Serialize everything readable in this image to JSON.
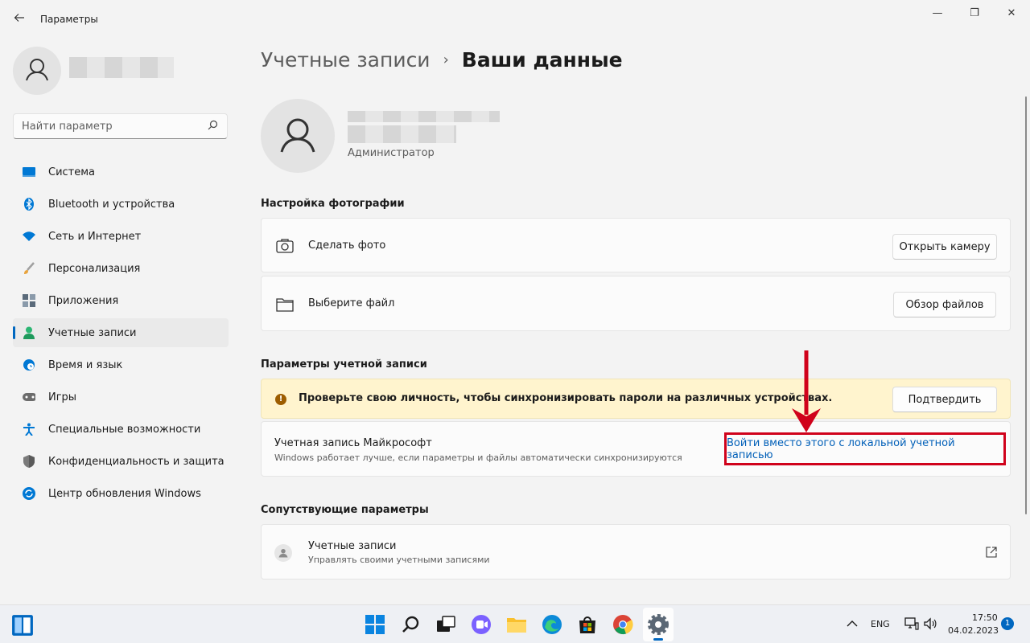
{
  "app": {
    "title": "Параметры"
  },
  "window_controls": {
    "minimize": "—",
    "maximize": "❐",
    "close": "✕"
  },
  "search": {
    "placeholder": "Найти параметр"
  },
  "sidebar": {
    "items": [
      {
        "label": "Система",
        "icon": "monitor-icon",
        "color": "#0078d4"
      },
      {
        "label": "Bluetooth и устройства",
        "icon": "bluetooth-icon",
        "color": "#0078d4"
      },
      {
        "label": "Сеть и Интернет",
        "icon": "wifi-icon",
        "color": "#0078d4"
      },
      {
        "label": "Персонализация",
        "icon": "brush-icon",
        "color": "#e8a33c"
      },
      {
        "label": "Приложения",
        "icon": "apps-icon",
        "color": "#5a6a7a"
      },
      {
        "label": "Учетные записи",
        "icon": "person-icon",
        "color": "#2bb673",
        "active": true
      },
      {
        "label": "Время и язык",
        "icon": "globe-clock-icon",
        "color": "#0078d4"
      },
      {
        "label": "Игры",
        "icon": "gamepad-icon",
        "color": "#6b6b6b"
      },
      {
        "label": "Специальные возможности",
        "icon": "accessibility-icon",
        "color": "#0078d4"
      },
      {
        "label": "Конфиденциальность и защита",
        "icon": "shield-icon",
        "color": "#7a7a7a"
      },
      {
        "label": "Центр обновления Windows",
        "icon": "update-icon",
        "color": "#0078d4"
      }
    ]
  },
  "breadcrumb": {
    "parent": "Учетные записи",
    "separator": "›",
    "current": "Ваши данные"
  },
  "profile": {
    "role": "Администратор"
  },
  "photo_section": {
    "heading": "Настройка фотографии",
    "take_photo": {
      "label": "Сделать фото",
      "button": "Открыть камеру"
    },
    "choose_file": {
      "label": "Выберите файл",
      "button": "Обзор файлов"
    }
  },
  "account_section": {
    "heading": "Параметры учетной записи",
    "warning": {
      "text": "Проверьте свою личность, чтобы синхронизировать пароли на различных устройствах.",
      "button": "Подтвердить",
      "icon": "!"
    },
    "microsoft_account": {
      "title": "Учетная запись Майкрософт",
      "subtitle": "Windows работает лучше, если параметры и файлы автоматически синхронизируются",
      "link": "Войти вместо этого с локальной учетной записью"
    }
  },
  "related_section": {
    "heading": "Сопутствующие параметры",
    "accounts": {
      "title": "Учетные записи",
      "subtitle": "Управлять своими учетными записями"
    }
  },
  "taskbar": {
    "lang": "ENG",
    "time": "17:50",
    "date": "04.02.2023",
    "notifications": "1"
  },
  "colors": {
    "accent": "#0067c0",
    "warning_bg": "#fff4ce",
    "highlight_red": "#d0021b"
  }
}
